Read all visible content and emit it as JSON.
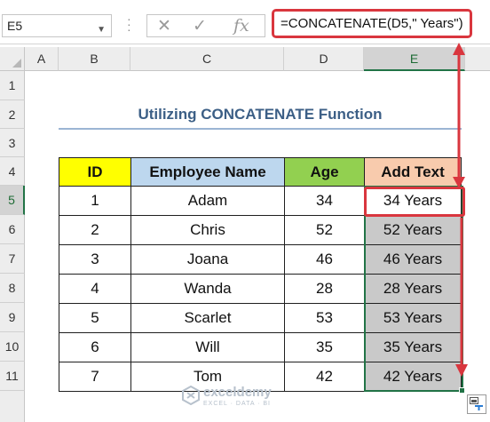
{
  "formula_bar": {
    "name_box": "E5",
    "cancel_icon": "✕",
    "enter_icon": "✓",
    "fx_label": "fx",
    "formula": "=CONCATENATE(D5,\" Years\")"
  },
  "columns": [
    "A",
    "B",
    "C",
    "D",
    "E"
  ],
  "rows": [
    "1",
    "2",
    "3",
    "4",
    "5",
    "6",
    "7",
    "8",
    "9",
    "10",
    "11"
  ],
  "active_cell": "E5",
  "title": "Utilizing CONCATENATE Function",
  "table": {
    "headers": [
      "ID",
      "Employee Name",
      "Age",
      "Add Text"
    ],
    "rows": [
      {
        "id": "1",
        "name": "Adam",
        "age": "34",
        "text": "34 Years"
      },
      {
        "id": "2",
        "name": "Chris",
        "age": "52",
        "text": "52 Years"
      },
      {
        "id": "3",
        "name": "Joana",
        "age": "46",
        "text": "46 Years"
      },
      {
        "id": "4",
        "name": "Wanda",
        "age": "28",
        "text": "28 Years"
      },
      {
        "id": "5",
        "name": "Scarlet",
        "age": "53",
        "text": "53 Years"
      },
      {
        "id": "6",
        "name": "Will",
        "age": "35",
        "text": "35 Years"
      },
      {
        "id": "7",
        "name": "Tom",
        "age": "42",
        "text": "42 Years"
      }
    ]
  },
  "watermark": {
    "name": "exceldemy",
    "tagline": "EXCEL · DATA · BI"
  },
  "colors": {
    "highlight": "#d9363e",
    "selection": "#217346",
    "id_header": "#ffff00",
    "name_header": "#bdd7ee",
    "age_header": "#92d050",
    "add_header": "#f8cbad",
    "filled": "#c9c9c9"
  }
}
